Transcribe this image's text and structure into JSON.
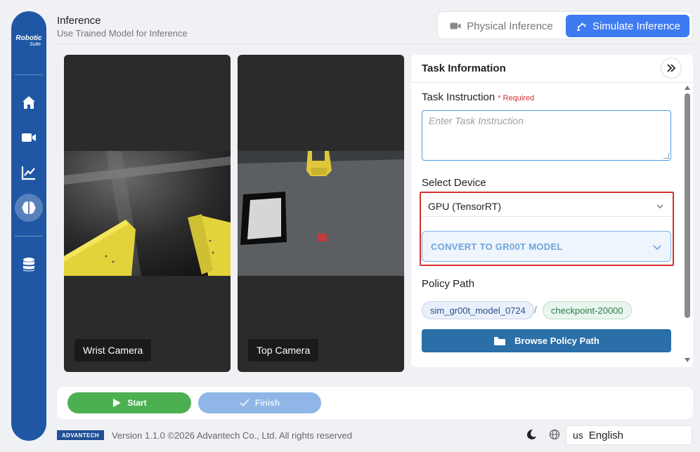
{
  "app": {
    "logo_line1": "Robotic",
    "logo_line2": "Suite"
  },
  "sidebar": {
    "items": [
      {
        "icon": "home-icon",
        "active": false
      },
      {
        "icon": "video-camera-icon",
        "active": false
      },
      {
        "icon": "chart-line-icon",
        "active": false
      },
      {
        "icon": "brain-icon",
        "active": true
      },
      {
        "icon": "database-icon",
        "active": false
      }
    ]
  },
  "header": {
    "title": "Inference",
    "subtitle": "Use Trained Model for Inference",
    "modes": [
      {
        "label": "Physical Inference",
        "icon": "video-camera-icon",
        "selected": false
      },
      {
        "label": "Simulate Inference",
        "icon": "robot-arm-icon",
        "selected": true
      }
    ]
  },
  "cameras": [
    {
      "label": "Wrist Camera"
    },
    {
      "label": "Top Camera"
    }
  ],
  "task_panel": {
    "title": "Task Information",
    "instruction_label": "Task Instruction",
    "required_text": "* Required",
    "instruction_placeholder": "Enter Task Instruction",
    "instruction_value": "",
    "device_label": "Select Device",
    "device_selected": "GPU (TensorRT)",
    "convert_label": "CONVERT TO GR00T MODEL",
    "policy_label": "Policy Path",
    "policy_model": "sim_gr00t_model_0724",
    "policy_separator": "/",
    "policy_checkpoint": "checkpoint-20000",
    "browse_label": "Browse Policy Path"
  },
  "controls": {
    "start_label": "Start",
    "finish_label": "Finish"
  },
  "footer": {
    "brand": "ADVANTECH",
    "version": "Version 1.1.0 ©2026 Advantech Co., Ltd. All rights reserved",
    "language_code": "us",
    "language": "English"
  },
  "colors": {
    "sidebar": "#1f57a4",
    "accent": "#3e7af0",
    "start": "#4caf50",
    "finish": "#8fb6e6",
    "browse": "#2a6fa8",
    "highlight": "#d32f2f"
  }
}
